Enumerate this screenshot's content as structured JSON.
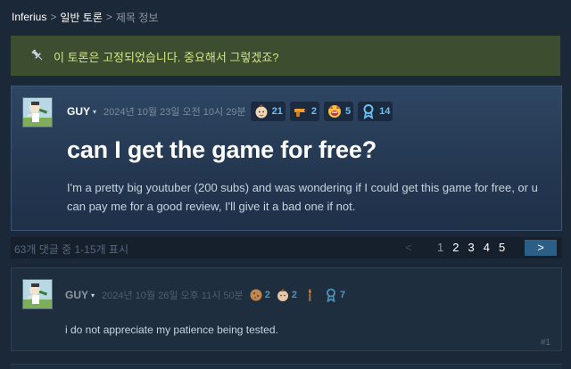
{
  "breadcrumb": {
    "app": "Inferius",
    "section": "일반 토론",
    "current": "제목 정보",
    "separator": ">"
  },
  "pinned_notice": {
    "icon": "pin-icon",
    "text": "이 토론은 고정되었습니다. 중요해서 그렇겠죠?"
  },
  "topic": {
    "author": "GUY",
    "caret": "▾",
    "timestamp": "2024년 10월 23일 오전 10시 29분",
    "awards": [
      {
        "icon": "baby-face-award-icon",
        "count": "21"
      },
      {
        "icon": "toy-gun-award-icon",
        "count": "2"
      },
      {
        "icon": "screaming-face-award-icon",
        "count": "5"
      },
      {
        "icon": "ribbon-award-icon",
        "count": "14"
      }
    ],
    "title": "can I get the game for free?",
    "body": "I'm a pretty big youtuber (200 subs) and was wondering if I could get this game for free, or u can pay me for a good review, I'll give it a bad one if not."
  },
  "pagination": {
    "summary": "63개 댓글 중 1-15개 표시",
    "prev": "<",
    "pages": [
      "1",
      "2",
      "3",
      "4",
      "5"
    ],
    "current_page": "1",
    "next": ">"
  },
  "comment": {
    "author": "GUY",
    "caret": "▾",
    "timestamp": "2024년 10월 26일 오후 11시 50분",
    "awards": [
      {
        "icon": "cookie-award-icon",
        "count": "2"
      },
      {
        "icon": "baby-face-award-icon",
        "count": "2"
      },
      {
        "icon": "torch-award-icon",
        "count": ""
      },
      {
        "icon": "ribbon-award-icon",
        "count": "7"
      }
    ],
    "text": "i do not appreciate my patience being tested.",
    "index": "#1"
  },
  "colors": {
    "page_bg": "#1b2838",
    "pinned_bg": "#3d4d2f",
    "pinned_text": "#d2e885",
    "accent": "#66c0f4",
    "next_button": "#2c5f86"
  }
}
